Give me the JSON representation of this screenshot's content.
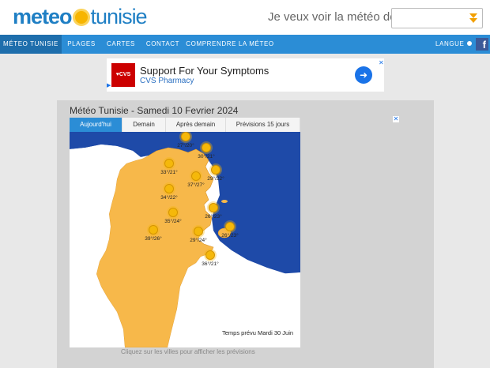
{
  "header": {
    "logo_left": "meteo",
    "logo_right": "tunisie",
    "search_label": "Je veux voir la météo de"
  },
  "nav": {
    "items": [
      "MÉTEO TUNISIE",
      "PLAGES",
      "CARTES",
      "CONTACT",
      "COMPRENDRE LA MÉTEO"
    ],
    "language": "LANGUE"
  },
  "ad": {
    "logo": "♥CVS",
    "title": "Support For Your Symptoms",
    "subtitle": "CVS Pharmacy"
  },
  "panel": {
    "title": "Météo Tunisie - Samedi 10 Fevrier 2024",
    "tabs": [
      "Aujourd'hui",
      "Demain",
      "Après demain",
      "Prévisions 15 jours"
    ],
    "map_caption": "Temps prévu Mardi 30 Juin",
    "footer_note": "Cliquez sur les villes pour afficher les prévisions"
  },
  "cities": [
    {
      "temp": "27°/20°"
    },
    {
      "temp": "30°/21°"
    },
    {
      "temp": "33°/21°"
    },
    {
      "temp": "29°/22°"
    },
    {
      "temp": "37°/27°"
    },
    {
      "temp": "34°/22°"
    },
    {
      "temp": "26°/23°"
    },
    {
      "temp": "35°/24°"
    },
    {
      "temp": "26°/23°"
    },
    {
      "temp": "39°/26°"
    },
    {
      "temp": "29°/24°"
    },
    {
      "temp": "36°/21°"
    }
  ],
  "colors": {
    "accent": "#2b8dd6",
    "sea": "#1e4aa8",
    "land": "#f7b84a"
  },
  "icons": {
    "sun": "sun-icon",
    "dropdown": "dropdown-arrow-icon",
    "facebook": "facebook-icon",
    "close": "close-icon"
  }
}
